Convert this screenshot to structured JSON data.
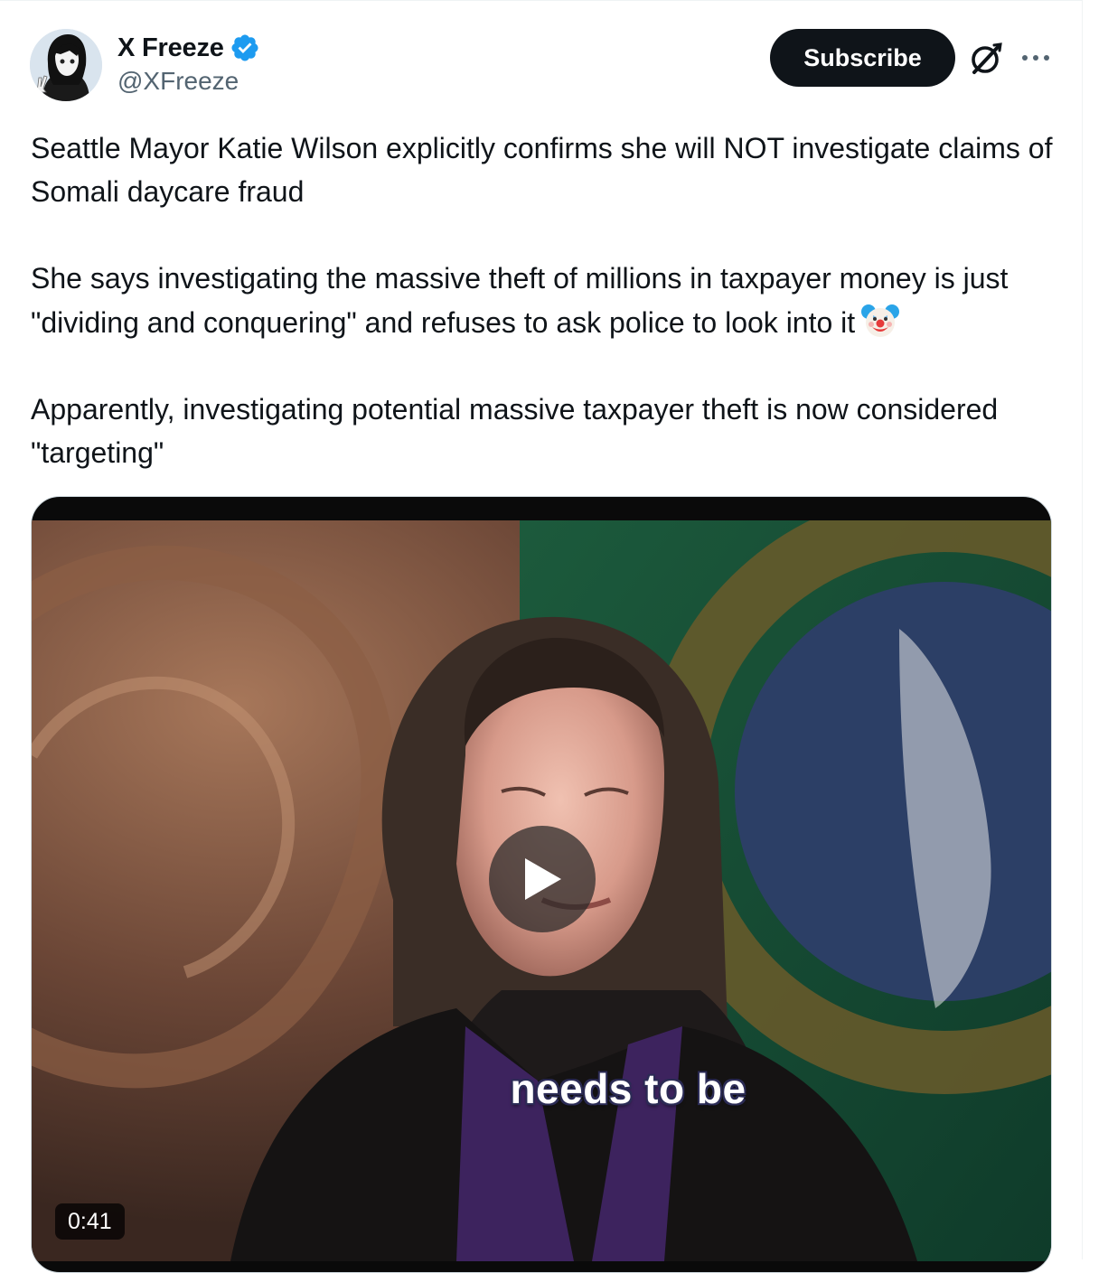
{
  "author": {
    "display_name": "X Freeze",
    "handle": "@XFreeze",
    "verified": true,
    "verified_color": "#1d9bf0"
  },
  "actions": {
    "subscribe_label": "Subscribe"
  },
  "icons": {
    "verified": "verified-badge-icon",
    "grok": "grok-icon",
    "more": "more-options-icon",
    "emoji": "clown-face-icon",
    "play": "play-icon"
  },
  "post": {
    "paragraphs": [
      "Seattle Mayor Katie Wilson explicitly confirms she will NOT investigate claims of Somali daycare fraud",
      "She says investigating the massive theft of millions in taxpayer money is just \"dividing and conquering\" and refuses to ask police to look into it",
      "Apparently, investigating potential massive taxpayer theft is now considered \"targeting\""
    ],
    "emoji_after_paragraph_2": "🤡"
  },
  "media": {
    "type": "video",
    "subtitle": "needs to be",
    "duration": "0:41"
  },
  "colors": {
    "text": "#0f1419",
    "secondary_text": "#536471",
    "button_bg": "#0f1419",
    "button_text": "#ffffff",
    "border": "#cfd9de"
  }
}
